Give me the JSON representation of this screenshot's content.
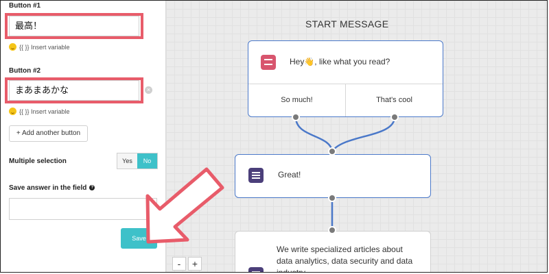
{
  "form": {
    "button1_label": "Button #1",
    "button1_value": "最高！",
    "button2_label": "Button #2",
    "button2_value": "まあまあかな",
    "insert_variable": "{{ }} Insert variable",
    "add_button": "+ Add another button",
    "multiple_selection_label": "Multiple selection",
    "toggle_yes": "Yes",
    "toggle_no": "No",
    "toggle_selected": "No",
    "save_answer_label": "Save answer in the field",
    "save_answer_value": "",
    "save_button": "Save"
  },
  "canvas": {
    "start_title": "START MESSAGE",
    "node1_text": "Hey👋, like what you read?",
    "option1": "So much!",
    "option2": "That's cool",
    "node2_text": "Great!",
    "node3_text": "We write specialized articles about data analytics, data security and data industry",
    "zoom_out": "-",
    "zoom_in": "+"
  },
  "colors": {
    "accent": "#3ec1c9",
    "highlight": "#e85c6a",
    "node_border": "#4a78c9",
    "connector": "#4a78c9"
  }
}
